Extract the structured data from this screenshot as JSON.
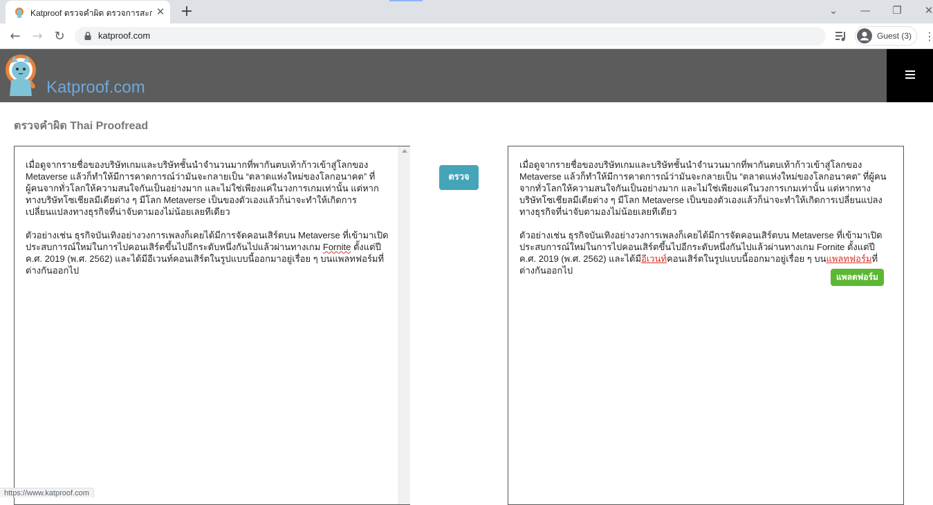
{
  "browser": {
    "tab_title": "Katproof ตรวจคำผิด ตรวจการสะกดคำ",
    "tab_close": "✕",
    "new_tab": "+",
    "window_controls": {
      "dropdown": "⌄",
      "minimize": "—",
      "restore": "❐",
      "close": "✕"
    },
    "nav": {
      "back": "←",
      "forward": "→",
      "reload": "↻"
    },
    "url": "katproof.com",
    "profile_label": "Guest (3)",
    "menu": "⋮",
    "status_url": "https://www.katproof.com"
  },
  "site": {
    "name": "Katproof.com",
    "brand_color": "#6fa8dc",
    "header_color": "#5c5c5c"
  },
  "page": {
    "title": "ตรวจคำผิด Thai Proofread"
  },
  "input_panel": {
    "paragraph1": "เมื่อดูจากรายชื่อของบริษัทเกมและบริษัทชั้นนำจำนวนมากที่พากันตบเท้าก้าวเข้าสู่โลกของ Metaverse แล้วก็ทำให้มีการคาดการณ์ว่ามันจะกลายเป็น “ตลาดแห่งใหม่ของโลกอนาคต” ที่ผู้คนจากทั่วโลกให้ความสนใจกันเป็นอย่างมาก และไม่ใช่เพียงแค่ในวงการเกมเท่านั้น แต่หากทางบริษัทโซเชียลมีเดียต่าง ๆ มีโลก Metaverse เป็นของตัวเองแล้วก็น่าจะทำให้เกิดการเปลี่ยนแปลงทางธุรกิจที่น่าจับตามองไม่น้อยเลยทีเดียว",
    "paragraph2_before": "ตัวอย่างเช่น ธุรกิจบันเทิงอย่างวงการเพลงก็เคยได้มีการจัดคอนเสิร์ตบน Metaverse ที่เข้ามาเปิดประสบการณ์ใหม่ในการไปคอนเสิร์ตขึ้นไปอีกระดับหนึ่งกันไปแล้วผ่านทางเกม ",
    "paragraph2_flagged": "Fornite",
    "paragraph2_after": " ตั้งแต่ปี ค.ศ. 2019 (พ.ศ. 2562) และได้มีอีเวนท์คอนเสิร์ตในรูปแบบนี้ออกมาอยู่เรื่อย ๆ บนแพลทฟอร์มที่ต่างกันออกไป"
  },
  "check_button_label": "ตรวจ",
  "output_panel": {
    "paragraph1": "เมื่อดูจากรายชื่อของบริษัทเกมและบริษัทชั้นนำจำนวนมากที่พากันตบเท้าก้าวเข้าสู่โลกของ Metaverse แล้วก็ทำให้มีการคาดการณ์ว่ามันจะกลายเป็น “ตลาดแห่งใหม่ของโลกอนาคต” ที่ผู้คนจากทั่วโลกให้ความสนใจกันเป็นอย่างมาก และไม่ใช่เพียงแค่ในวงการเกมเท่านั้น แต่หากทางบริษัทโซเชียลมีเดียต่าง ๆ มีโลก Metaverse เป็นของตัวเองแล้วก็น่าจะทำให้เกิดการเปลี่ยนแปลงทางธุรกิจที่น่าจับตามองไม่น้อยเลยทีเดียว",
    "paragraph2_part1": "ตัวอย่างเช่น ธุรกิจบันเทิงอย่างวงการเพลงก็เคยได้มีการจัดคอนเสิร์ตบน Metaverse ที่เข้ามาเปิดประสบการณ์ใหม่ในการไปคอนเสิร์ตขึ้นไปอีกระดับหนึ่งกันไปแล้วผ่านทางเกม Fornite ตั้งแต่ปี ค.ศ. 2019 (พ.ศ. 2562) และได้มี",
    "error1": "อีเวนท์",
    "paragraph2_part2": "คอนเสิร์ตในรูปแบบนี้ออกมาอยู่เรื่อย ๆ บน",
    "error2": "แพลทฟอร์ม",
    "paragraph2_part3": "ที่ต่างกันออกไป",
    "error_color": "#d93025"
  },
  "suggestion": {
    "text": "แพลตฟอร์ม",
    "color": "#5cb832"
  }
}
